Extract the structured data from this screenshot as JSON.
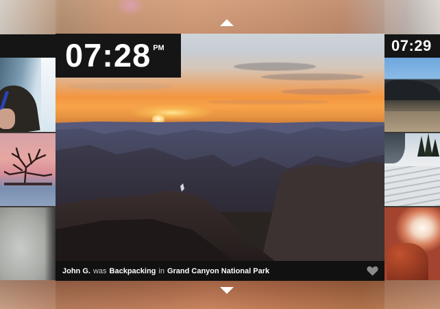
{
  "clock": {
    "time": "07:28",
    "meridiem": "PM",
    "next_time": "07:29"
  },
  "feature": {
    "user": "John G.",
    "verb": "was",
    "activity": "Backpacking",
    "preposition": "in",
    "location": "Grand Canyon National Park"
  },
  "icons": {
    "up": "chevron-up-icon",
    "down": "chevron-down-icon",
    "like": "heart-icon"
  },
  "colors": {
    "bar": "#151515",
    "caption_bg": "#111111",
    "heart": "#8a8a8a"
  }
}
